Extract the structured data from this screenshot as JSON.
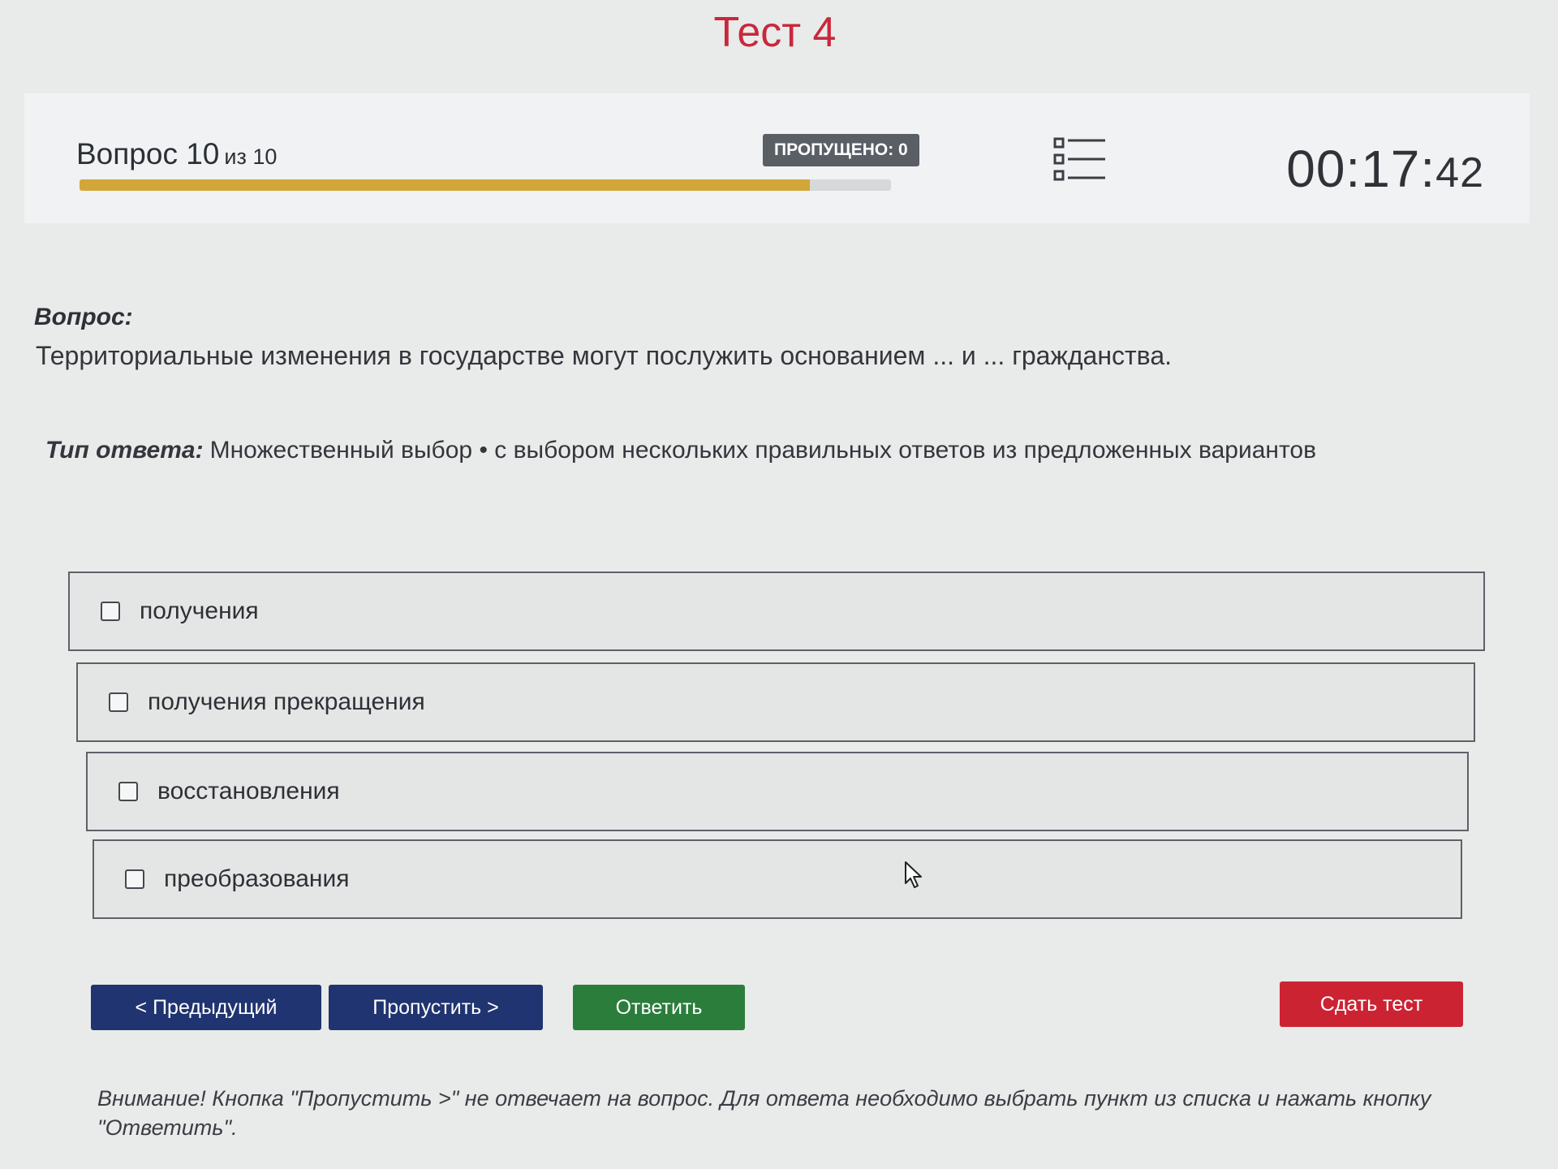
{
  "header": {
    "test_title": "Тест 4",
    "question_label": "Вопрос 10",
    "question_of": "из 10",
    "progress_fraction": 0.9,
    "skipped_badge": "ПРОПУЩЕНО: 0",
    "list_icon": "list-icon",
    "timer_main": "00:17:",
    "timer_seconds": "42"
  },
  "question": {
    "label": "Вопрос:",
    "text": "Территориальные изменения в государстве могут послужить основанием ... и ... гражданства."
  },
  "answer_type": {
    "label": "Тип ответа:",
    "value": "Множественный выбор • с выбором нескольких правильных ответов из предложенных вариантов"
  },
  "options": [
    {
      "label": "получения",
      "checked": false
    },
    {
      "label": "получения прекращения",
      "checked": false
    },
    {
      "label": "восстановления",
      "checked": false
    },
    {
      "label": "преобразования",
      "checked": false
    }
  ],
  "buttons": {
    "prev": "< Предыдущий",
    "skip": "Пропустить >",
    "answer": "Ответить",
    "submit": "Сдать тест"
  },
  "notice": "Внимание! Кнопка \"Пропустить >\" не отвечает на вопрос. Для ответа необходимо выбрать пункт из списка и нажать кнопку \"Ответить\".",
  "colors": {
    "title": "#c8283b",
    "progress": "#d2a638",
    "nav_button": "#1f3470",
    "answer_button": "#2b7d3b",
    "submit_button": "#cc2333"
  }
}
